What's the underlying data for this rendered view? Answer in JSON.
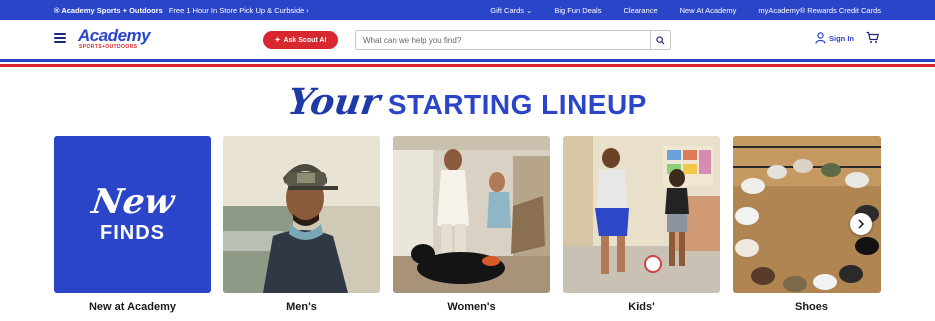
{
  "topbar": {
    "brand": "® Academy Sports + Outdoors",
    "promo": "Free 1 Hour In Store Pick Up & Curbside",
    "links": [
      "Gift Cards",
      "Big Fun Deals",
      "Clearance",
      "New At Academy",
      "myAcademy® Rewards Credit Cards"
    ]
  },
  "header": {
    "logo_main": "Academy",
    "logo_sub": "SPORTS+OUTDOORS",
    "scout_label": "Ask Scout AI",
    "search_placeholder": "What can we help you find?",
    "signin_label": "Sign In"
  },
  "headline": {
    "script": "Your",
    "bold": "STARTING LINEUP"
  },
  "cards": [
    {
      "label": "New at Academy",
      "tile_line1": "New",
      "tile_line2": "FINDS"
    },
    {
      "label": "Men's"
    },
    {
      "label": "Women's"
    },
    {
      "label": "Kids'"
    },
    {
      "label": "Shoes"
    }
  ],
  "colors": {
    "brand_blue": "#2b45c9",
    "brand_red": "#d7282f"
  }
}
